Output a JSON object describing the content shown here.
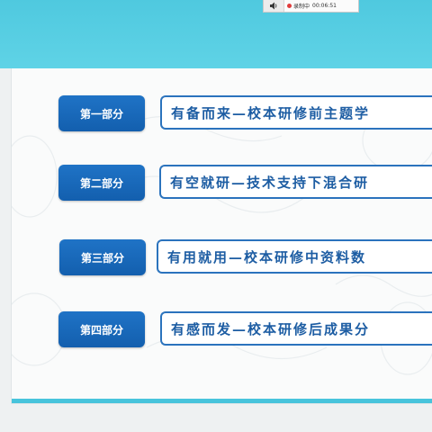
{
  "recorder": {
    "status": "录制中",
    "time": "00:06:51"
  },
  "slide": {
    "sections": [
      {
        "label": "第一部分",
        "title": "有备而来—校本研修前主题学"
      },
      {
        "label": "第二部分",
        "title": "有空就研—技术支持下混合研"
      },
      {
        "label": "第三部分",
        "title": "有用就用—校本研修中资料数"
      },
      {
        "label": "第四部分",
        "title": "有感而发—校本研修后成果分"
      }
    ]
  },
  "colors": {
    "header_band": "#4fc9df",
    "label_bg": "#1a69bb",
    "title_border": "#2b73bd",
    "title_text": "#1d5da3",
    "record_dot": "#e03c3c"
  },
  "icons": [
    "speaker-icon",
    "record-dot-icon"
  ]
}
